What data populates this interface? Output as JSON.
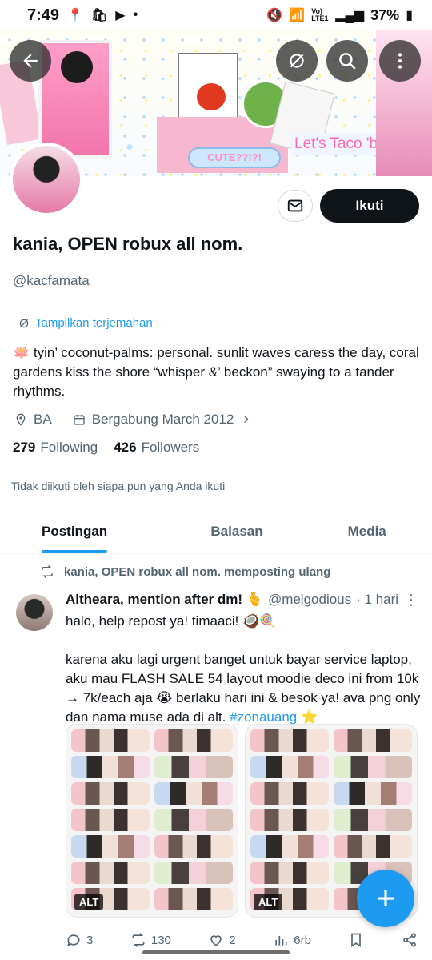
{
  "status_bar": {
    "time": "7:49",
    "battery": "37%",
    "lte_label": "Vo) LTE1",
    "icons": [
      "location-icon",
      "bag-icon",
      "youtube-icon",
      "dot-icon",
      "mute-icon",
      "wifi-icon",
      "signal-icon",
      "battery-icon"
    ]
  },
  "banner": {
    "cute_text": "CUTE??!?!",
    "taco_text": "Let's Taco 'bout it",
    "tomato_label": "tomato"
  },
  "profile": {
    "display_name": "kania, OPEN robux all nom.",
    "handle": "@kacfamata",
    "translate_label": "Tampilkan terjemahan",
    "bio": "🪷 tyin’ coconut-palms: personal. sunlit waves caress the day, coral gardens kiss the shore “whisper &’ beckon” swaying to a tander rhythms.",
    "location": "BA",
    "joined": "Bergabung March 2012",
    "following_count": "279",
    "following_label": "Following",
    "followers_count": "426",
    "followers_label": "Followers",
    "not_followed_text": "Tidak diikuti oleh siapa pun yang Anda ikuti",
    "follow_button": "Ikuti"
  },
  "tabs": [
    {
      "label": "Postingan",
      "active": true
    },
    {
      "label": "Balasan",
      "active": false
    },
    {
      "label": "Media",
      "active": false
    }
  ],
  "post": {
    "repost_label": "kania, OPEN robux all nom. memposting ulang",
    "author_name": "Altheara, mention after dm! 🫰",
    "author_handle": "@melgodious",
    "time": "· 1 hari",
    "text_line1": "halo, help repost ya! timaaci! 🥥🍭",
    "text_line2": "karena aku lagi urgent banget untuk bayar service laptop, aku mau FLASH SALE 54 layout moodie deco ini from 10k → 7k/each aja 😭 berlaku hari ini & besok ya! ava png only dan nama muse ada di alt.",
    "hashtag": "#zonauang",
    "hashtag_emoji": "⭐",
    "alt_label": "ALT",
    "replies": "3",
    "reposts": "130",
    "likes": "2",
    "views": "6rb"
  },
  "colors": {
    "accent": "#1d9bf0",
    "text": "#0f1419",
    "muted": "#536471"
  }
}
